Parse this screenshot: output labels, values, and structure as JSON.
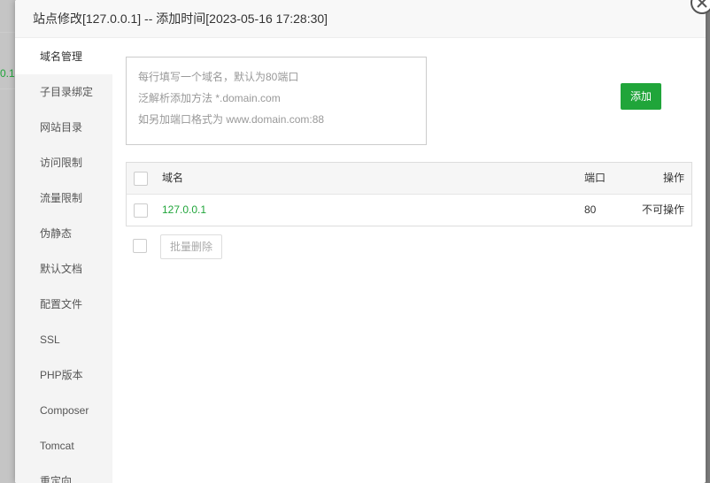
{
  "background": {
    "partial_text": "0.1"
  },
  "dialog": {
    "title": "站点修改[127.0.0.1] -- 添加时间[2023-05-16 17:28:30]",
    "close_icon": "close-icon"
  },
  "sidebar": {
    "items": [
      {
        "label": "域名管理",
        "active": true
      },
      {
        "label": "子目录绑定"
      },
      {
        "label": "网站目录"
      },
      {
        "label": "访问限制"
      },
      {
        "label": "流量限制"
      },
      {
        "label": "伪静态"
      },
      {
        "label": "默认文档"
      },
      {
        "label": "配置文件"
      },
      {
        "label": "SSL"
      },
      {
        "label": "PHP版本"
      },
      {
        "label": "Composer"
      },
      {
        "label": "Tomcat"
      },
      {
        "label": "重定向"
      }
    ]
  },
  "domain_input": {
    "placeholder_lines": [
      "每行填写一个域名，默认为80端口",
      "泛解析添加方法 *.domain.com",
      "如另加端口格式为 www.domain.com:88"
    ],
    "value": ""
  },
  "add_button": {
    "label": "添加"
  },
  "table": {
    "headers": {
      "domain": "域名",
      "port": "端口",
      "op": "操作"
    },
    "rows": [
      {
        "domain": "127.0.0.1",
        "port": "80",
        "op": "不可操作"
      }
    ]
  },
  "batch_delete": {
    "label": "批量删除"
  },
  "colors": {
    "accent": "#20a53a"
  }
}
